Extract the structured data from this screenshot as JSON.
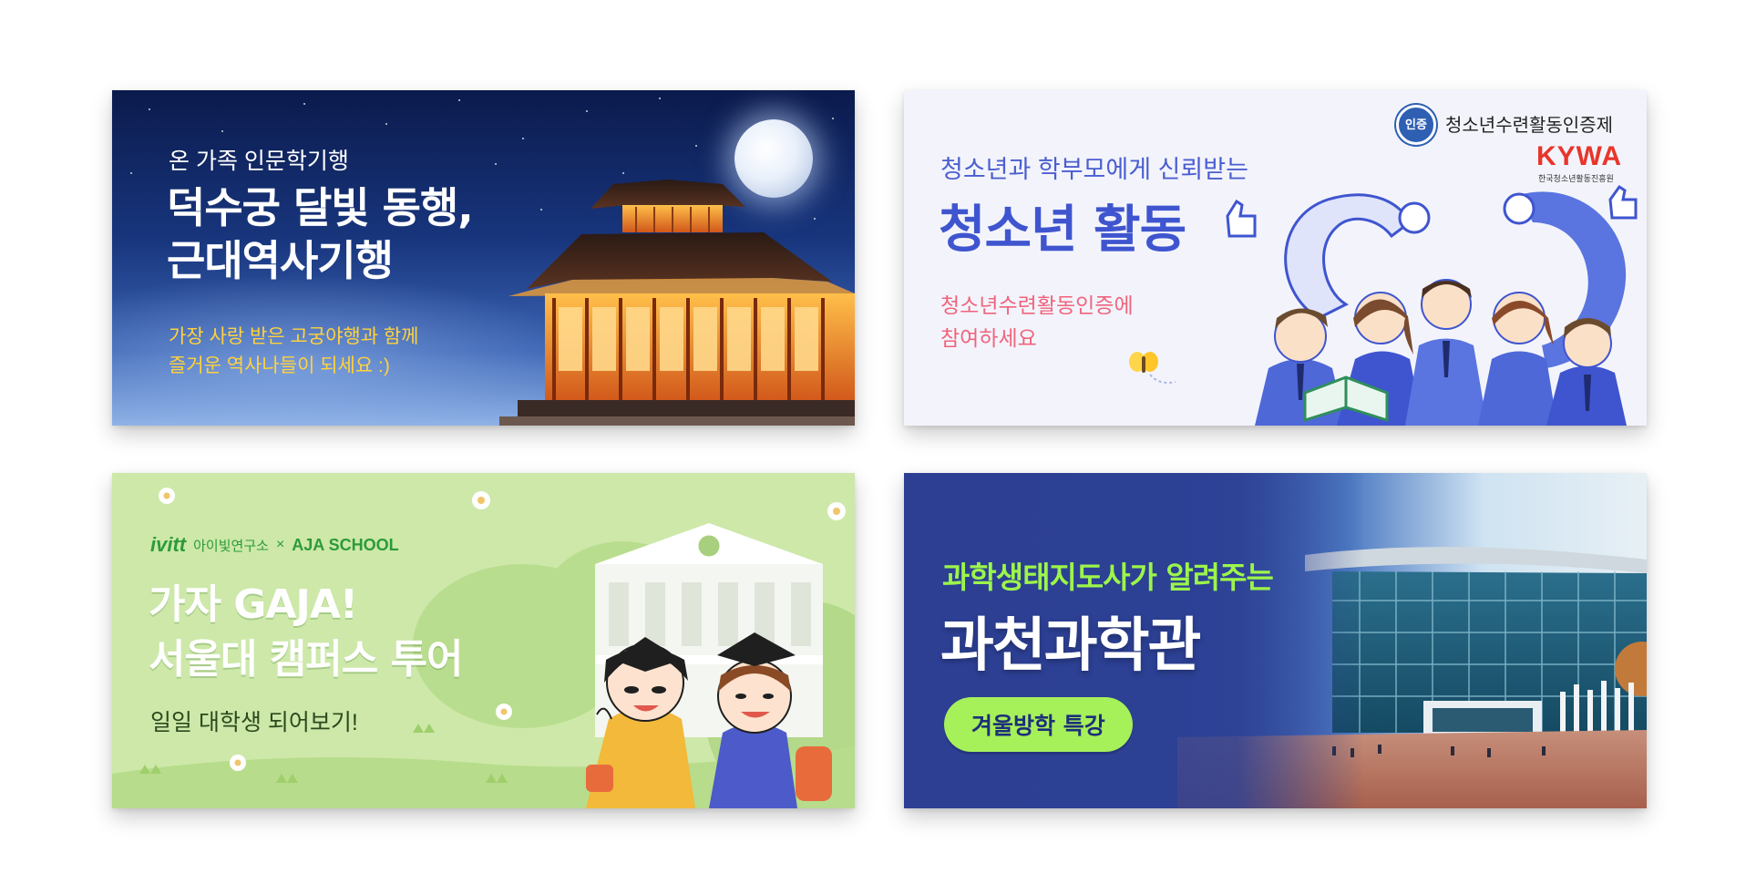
{
  "banners": [
    {
      "eyebrow": "온 가족 인문학기행",
      "title_line1": "덕수궁 달빛 동행,",
      "title_line2": "근대역사기행",
      "sub_line1": "가장 사랑 받은 고궁야행과 함께",
      "sub_line2": "즐거운 역사나들이 되세요 :)"
    },
    {
      "badge": "인증",
      "cert_label": "청소년수련활동인증제",
      "logo": "KYWA",
      "logo_sub": "한국청소년활동진흥원",
      "eyebrow": "청소년과 학부모에게 신뢰받는",
      "title": "청소년 활동",
      "sub_line1": "청소년수련활동인증에",
      "sub_line2": "참여하세요"
    },
    {
      "brand_ivitt": "ivitt",
      "brand_kr": "아이빛연구소",
      "brand_x": "×",
      "brand_aja": "AJA SCHOOL",
      "title_line1": "가자 GAJA!",
      "title_line2": "서울대 캠퍼스 투어",
      "sub": "일일 대학생 되어보기!"
    },
    {
      "eyebrow": "과학생태지도사가 알려주는",
      "title": "과천과학관",
      "pill": "겨울방학 특강"
    }
  ],
  "colors": {
    "c1_sub": "#ffd23c",
    "c2_blue": "#3f55cf",
    "c2_pink": "#f0647d",
    "c2_logo": "#e8352b",
    "c3_bg": "#cde8a9",
    "c3_green": "#2c9b3a",
    "c4_accent": "#9cf54a",
    "c4_pill": "#a6f05a"
  }
}
